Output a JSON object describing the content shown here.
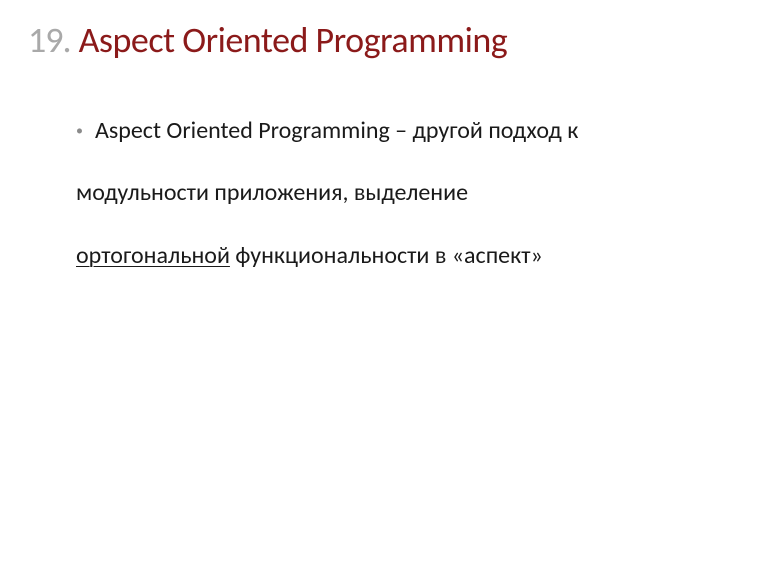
{
  "slide": {
    "number": "19.",
    "title": "Aspect Oriented Programming",
    "bullet_marker": "•",
    "line1": "Aspect Oriented Programming – другой подход к",
    "line2": "модульности приложения, выделение",
    "line3_underlined": "ортогональной",
    "line3_rest": " функциональности в «аспект»"
  }
}
